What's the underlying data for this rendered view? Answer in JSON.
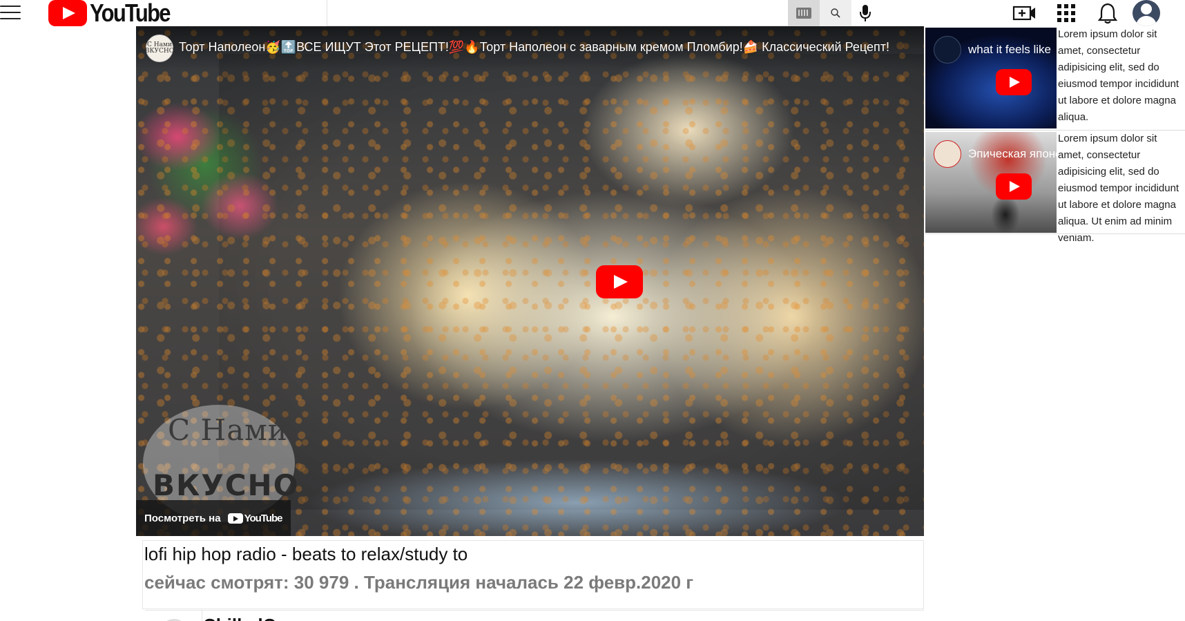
{
  "header": {
    "logo_text": "YouTube",
    "search": {
      "value": "",
      "placeholder": ""
    },
    "icons": [
      "menu-icon",
      "keyboard-icon",
      "search-icon",
      "microphone-icon",
      "create-video-icon",
      "apps-grid-icon",
      "notifications-bell-icon",
      "account-avatar-icon"
    ]
  },
  "player": {
    "channel_avatar_text": "С Нами ВКУСНО",
    "title": "Торт Наполеон🥳🔝ВСЕ ИЩУТ Этот РЕЦЕПТ!💯🔥Торт Наполеон с заварным кремом Пломбир!🍰 Классический Рецепт!",
    "watermark_line1": "С Нами",
    "watermark_line2": "ВКУСНО",
    "watch_on_label": "Посмотреть на",
    "watch_on_brand": "YouTube"
  },
  "video_info": {
    "title": "lofi hip hop radio - beats to relax/study to",
    "stats": "сейчас смотрят: 30 979 . Трансляция началась 22 февр.2020 г",
    "channel_name": "ChilledCow"
  },
  "rail": [
    {
      "thumb_title": "what it feels like",
      "text": "Lorem ipsum dolor sit amet, consectetur adipisicing elit, sed do eiusmod tempor incididunt ut labore et dolore magna aliqua."
    },
    {
      "thumb_title": "Эпическая японская",
      "text": "Lorem ipsum dolor sit amet, consectetur adipisicing elit, sed do eiusmod tempor incididunt ut labore et dolore magna aliqua. Ut enim ad minim veniam."
    }
  ],
  "colors": {
    "brand_red": "#ff0000",
    "stats_gray": "#7a7a7a",
    "border": "#e5e5e5"
  }
}
